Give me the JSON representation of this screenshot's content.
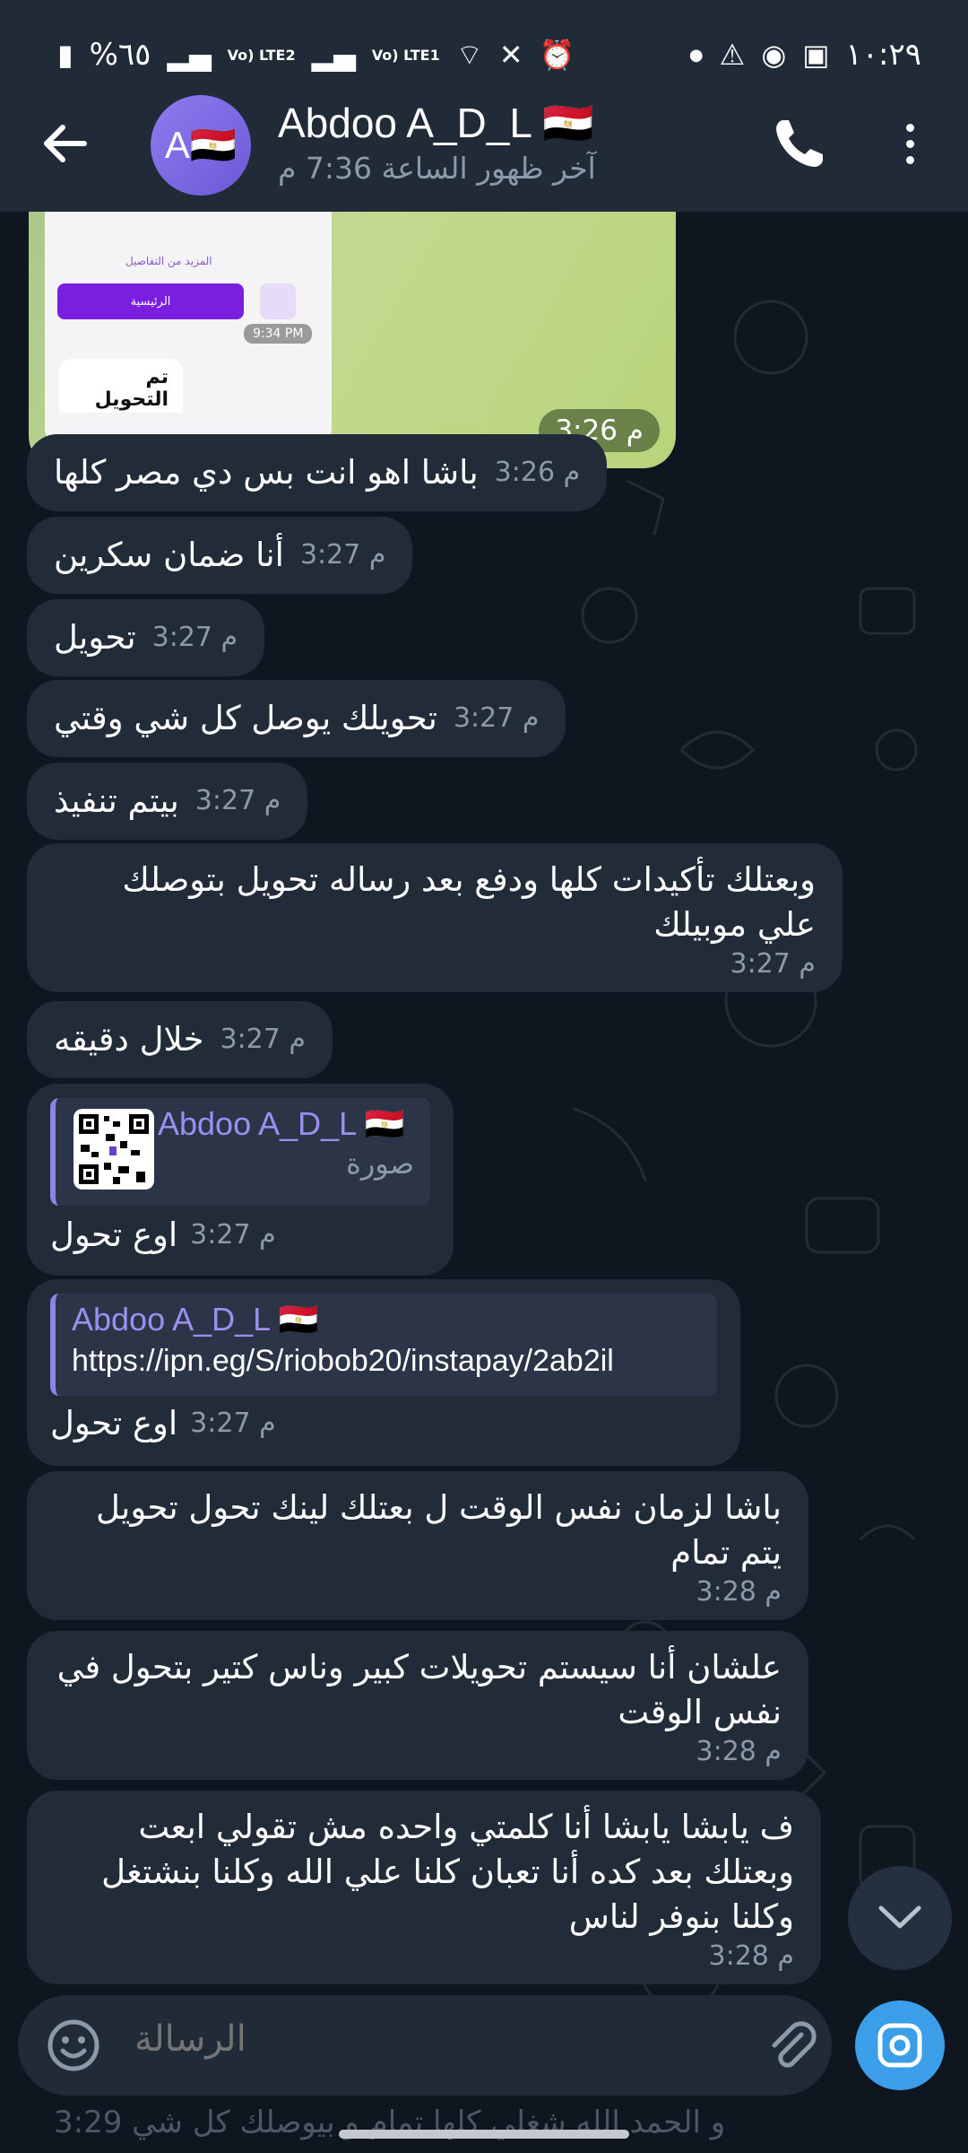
{
  "status_bar": {
    "battery": "%٦٥",
    "clock": "١٠:٢٩",
    "net1": "Vo) LTE2",
    "net2": "Vo) LTE1"
  },
  "header": {
    "name": "Abdoo A_D_L 🇪🇬",
    "avatar_letter": "A🇪🇬",
    "last_seen": "آخر ظهور الساعة 7:36 م"
  },
  "image_message": {
    "screenshot_more_details": "المزيد من التفاصيل",
    "screenshot_home_btn": "الرئيسية",
    "screenshot_time": "9:34 PM",
    "screenshot_card_title": "تم التحويل",
    "time": "3:26 م"
  },
  "messages": [
    {
      "text": "باشا اهو انت بس دي مصر كلها",
      "time": "3:26 م"
    },
    {
      "text": "أنا ضمان سكرين",
      "time": "3:27 م"
    },
    {
      "text": "تحويل",
      "time": "3:27 م"
    },
    {
      "text": "تحويلك يوصل كل شي وقتي",
      "time": "3:27 م"
    },
    {
      "text": "بيتم تنفيذ",
      "time": "3:27 م"
    },
    {
      "text": "وبعتلك تأكيدات كلها ودفع بعد رساله تحويل بتوصلك علي موبيلك",
      "time": "3:27 م"
    },
    {
      "text": "خلال دقيقه",
      "time": "3:27 م"
    },
    {
      "quote_name": "Abdoo A_D_L 🇪🇬",
      "quote_sub": "صورة",
      "text": "اوع تحول",
      "time": "3:27 م"
    },
    {
      "quote_name": "Abdoo A_D_L 🇪🇬",
      "quote_link": "https://ipn.eg/S/riobob20/instapay/2ab2il",
      "text": "اوع تحول",
      "time": "3:27 م"
    },
    {
      "text": "باشا لزمان نفس الوقت ل بعتلك لينك تحول تحويل يتم تمام",
      "time": "3:28 م"
    },
    {
      "text": "علشان أنا سيستم تحويلات كبير وناس كتير بتحول في نفس الوقت",
      "time": "3:28 م"
    },
    {
      "text": "ف يابشا يابشا أنا كلمتي واحده مش تقولي ابعت وبعتلك بعد كده أنا تعبان كلنا علي الله وكلنا بنشتغل وكلنا بنوفر لناس",
      "time": "3:28 م"
    }
  ],
  "input": {
    "placeholder": "الرسالة"
  },
  "behind_text": "و الحمد الله شغلي كلها تمام و بيوصلك كل شي 3:29"
}
